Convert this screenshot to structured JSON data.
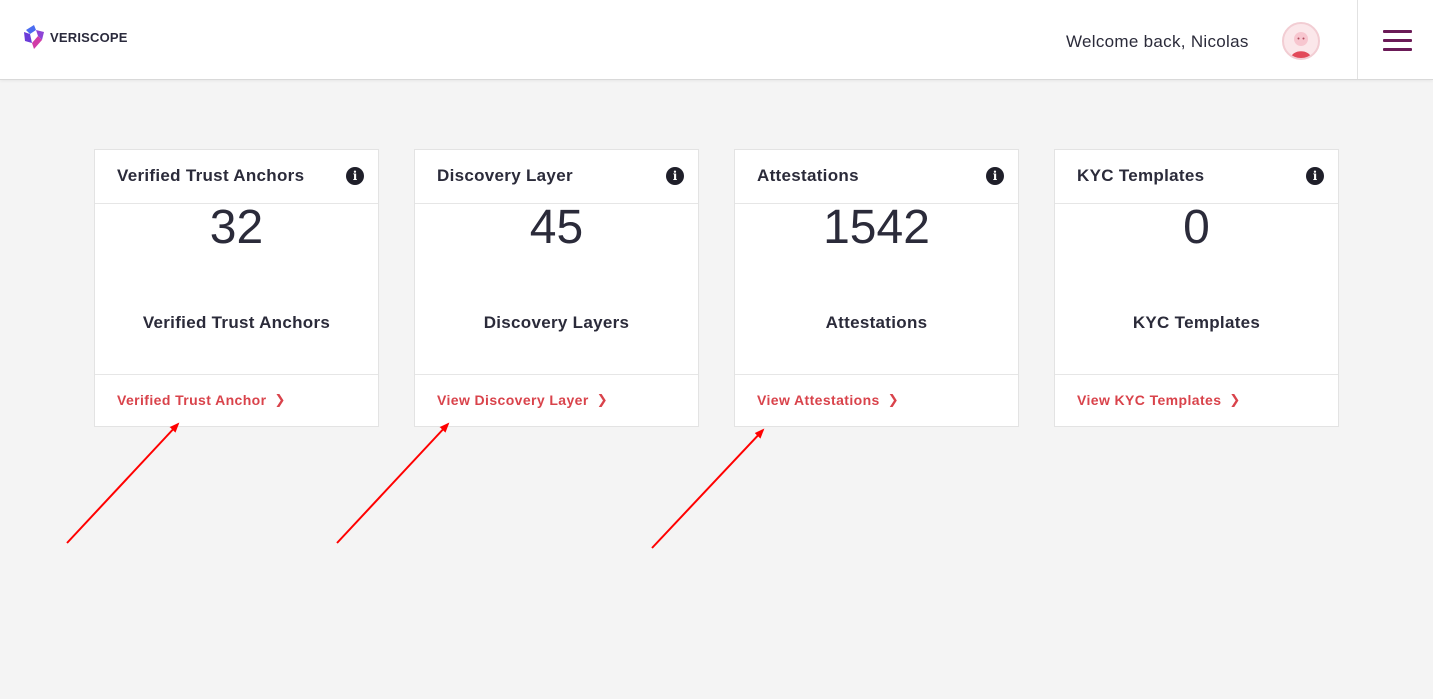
{
  "header": {
    "logo_text": "VERISCOPE",
    "welcome_text": "Welcome back, Nicolas",
    "accent_color": "#6b1a57"
  },
  "cards": [
    {
      "title": "Verified Trust Anchors",
      "value": "32",
      "subtitle": "Verified Trust Anchors",
      "link": "Verified Trust Anchor"
    },
    {
      "title": "Discovery Layer",
      "value": "45",
      "subtitle": "Discovery Layers",
      "link": "View Discovery Layer"
    },
    {
      "title": "Attestations",
      "value": "1542",
      "subtitle": "Attestations",
      "link": "View Attestations"
    },
    {
      "title": "KYC Templates",
      "value": "0",
      "subtitle": "KYC Templates",
      "link": "View KYC Templates"
    }
  ],
  "colors": {
    "link": "#d9434b",
    "annotation_arrow": "#ff0000",
    "background": "#f4f4f4"
  },
  "icons": {
    "info": "info-icon",
    "chevron": "chevron-right-icon",
    "menu": "hamburger-menu-icon",
    "logo": "veriscope-logo-icon",
    "avatar": "user-avatar"
  }
}
